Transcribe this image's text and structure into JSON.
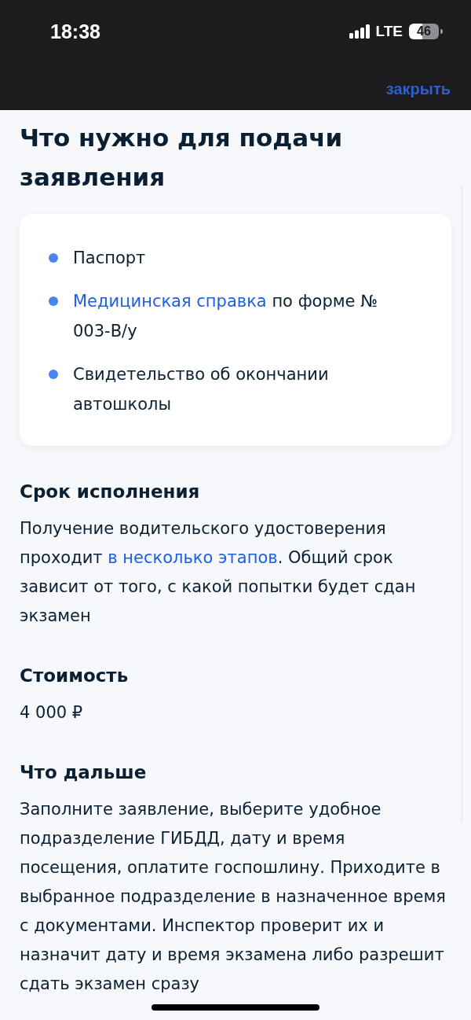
{
  "status_bar": {
    "time": "18:38",
    "network": "LTE",
    "battery": "46"
  },
  "header": {
    "close_link": "закрыть"
  },
  "title": "Что нужно для подачи заявления",
  "requirements": [
    {
      "parts": [
        {
          "kind": "text",
          "text": "Паспорт"
        }
      ]
    },
    {
      "parts": [
        {
          "kind": "link",
          "text": "Медицинская справка"
        },
        {
          "kind": "text",
          "text": " по форме № 003-В/у"
        }
      ]
    },
    {
      "parts": [
        {
          "kind": "text",
          "text": "Свидетельство об окончании автошколы"
        }
      ]
    }
  ],
  "sections": [
    {
      "heading": "Срок исполнения",
      "parts": [
        {
          "kind": "text",
          "text": "Получение водительского удостоверения проходит "
        },
        {
          "kind": "link",
          "text": "в несколько этапов"
        },
        {
          "kind": "text",
          "text": ". Общий срок зависит от того, с какой попытки будет сдан экзамен"
        }
      ]
    },
    {
      "heading": "Стоимость",
      "parts": [
        {
          "kind": "text",
          "text": "4 000 ₽"
        }
      ]
    },
    {
      "heading": "Что дальше",
      "parts": [
        {
          "kind": "text",
          "text": "Заполните заявление, выберите удобное подразделение ГИБДД, дату и время посещения, оплатите госпошлину. Приходите в выбранное подразделение в назначенное время с документами. Инспектор проверит их и назначит дату и время экзамена либо разрешит сдать экзамен сразу"
        }
      ]
    }
  ]
}
